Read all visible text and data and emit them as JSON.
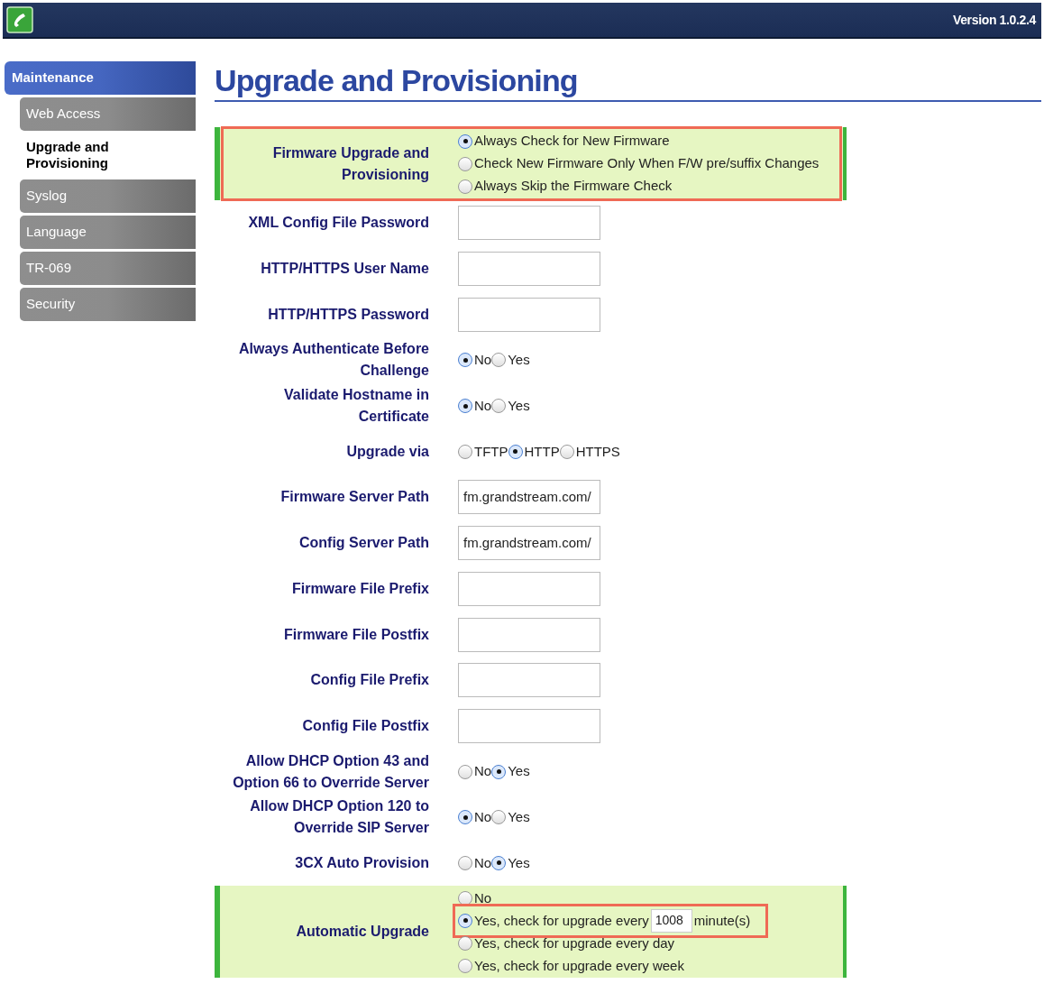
{
  "header": {
    "version": "Version 1.0.2.4"
  },
  "sidebar": {
    "section": {
      "label": "Maintenance",
      "selected": true
    },
    "items": [
      {
        "label": "Web Access",
        "selected": false
      },
      {
        "label": "Upgrade and Provisioning",
        "selected": true
      },
      {
        "label": "Syslog",
        "selected": false
      },
      {
        "label": "Language",
        "selected": false
      },
      {
        "label": "TR-069",
        "selected": false
      },
      {
        "label": "Security",
        "selected": false
      }
    ]
  },
  "page_title": "Upgrade and Provisioning",
  "fields": [
    {
      "kind": "radio_list",
      "label": "Firmware Upgrade and Provisioning",
      "highlighted": true,
      "outlined": true,
      "options": [
        {
          "label": "Always Check for New Firmware",
          "selected": true
        },
        {
          "label": "Check New Firmware Only When F/W pre/suffix Changes",
          "selected": false
        },
        {
          "label": "Always Skip the Firmware Check",
          "selected": false
        }
      ]
    },
    {
      "kind": "text",
      "label": "XML Config File Password",
      "highlighted": false
    },
    {
      "kind": "text",
      "label": "HTTP/HTTPS User Name",
      "highlighted": false
    },
    {
      "kind": "text",
      "label": "HTTP/HTTPS Password",
      "highlighted": false
    },
    {
      "kind": "radio_inline",
      "label": "Always Authenticate Before Challenge",
      "highlighted": false,
      "options": [
        {
          "label": "No",
          "selected": true
        },
        {
          "label": "Yes",
          "selected": false
        }
      ]
    },
    {
      "kind": "radio_inline",
      "label": "Validate Hostname in Certificate",
      "highlighted": false,
      "options": [
        {
          "label": "No",
          "selected": true
        },
        {
          "label": "Yes",
          "selected": false
        }
      ]
    },
    {
      "kind": "radio_inline",
      "label": "Upgrade via",
      "highlighted": false,
      "options": [
        {
          "label": "TFTP",
          "selected": false
        },
        {
          "label": "HTTP",
          "selected": true
        },
        {
          "label": "HTTPS",
          "selected": false
        }
      ]
    },
    {
      "kind": "text",
      "label": "Firmware Server Path",
      "highlighted": false,
      "value": "fm.grandstream.com/"
    },
    {
      "kind": "text",
      "label": "Config Server Path",
      "highlighted": false,
      "value": "fm.grandstream.com/"
    },
    {
      "kind": "text",
      "label": "Firmware File Prefix",
      "highlighted": false
    },
    {
      "kind": "text",
      "label": "Firmware File Postfix",
      "highlighted": false
    },
    {
      "kind": "text",
      "label": "Config File Prefix",
      "highlighted": false
    },
    {
      "kind": "text",
      "label": "Config File Postfix",
      "highlighted": false
    },
    {
      "kind": "radio_inline",
      "label": "Allow DHCP Option 43 and Option 66 to Override Server",
      "highlighted": false,
      "options": [
        {
          "label": "No",
          "selected": false
        },
        {
          "label": "Yes",
          "selected": true
        }
      ]
    },
    {
      "kind": "radio_inline",
      "label": "Allow DHCP Option 120 to Override SIP Server",
      "highlighted": false,
      "options": [
        {
          "label": "No",
          "selected": true
        },
        {
          "label": "Yes",
          "selected": false
        }
      ]
    },
    {
      "kind": "radio_inline",
      "label": "3CX Auto Provision",
      "highlighted": false,
      "options": [
        {
          "label": "No",
          "selected": false
        },
        {
          "label": "Yes",
          "selected": true
        }
      ]
    },
    {
      "kind": "radio_list",
      "label": "Automatic Upgrade",
      "highlighted": true,
      "outlined": false,
      "options": [
        {
          "label": "No",
          "selected": false
        },
        {
          "label": "Yes, check for upgrade every",
          "selected": true,
          "outlined": true,
          "interval": "1008",
          "suffix": "minute(s)"
        },
        {
          "label": "Yes, check for upgrade every day",
          "selected": false
        },
        {
          "label": "Yes, check for upgrade every week",
          "selected": false
        }
      ]
    }
  ]
}
